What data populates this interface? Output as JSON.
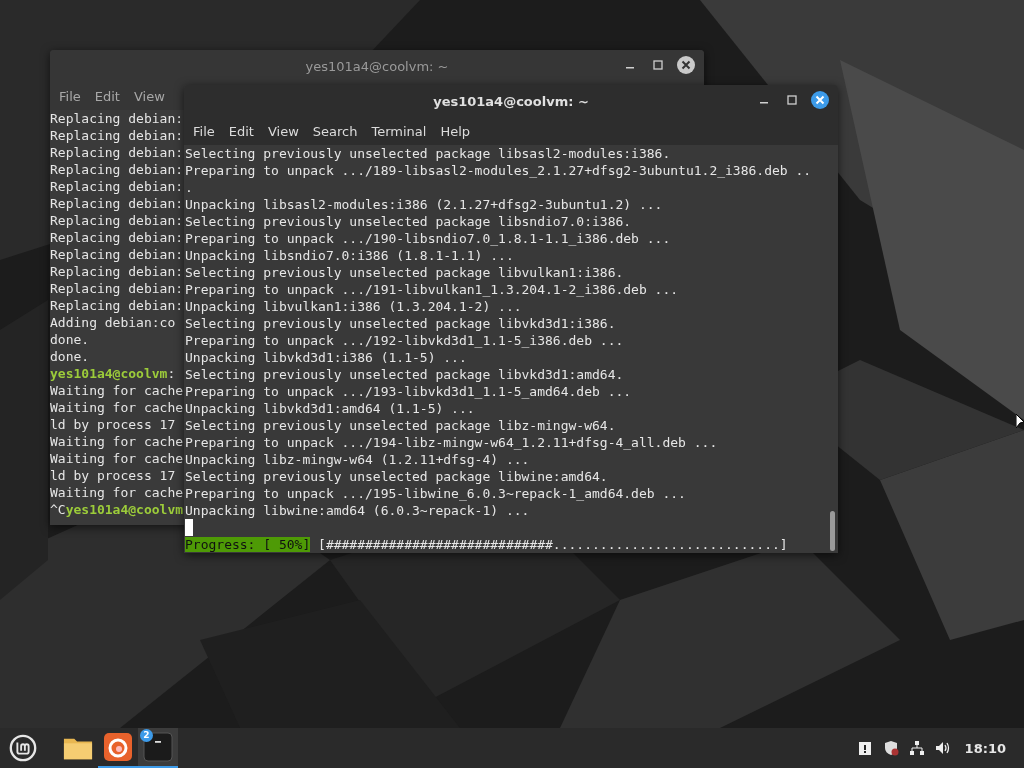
{
  "windows": [
    {
      "title": "yes101a4@coolvm: ~",
      "focused": false,
      "menu": [
        "File",
        "Edit",
        "View"
      ],
      "lines": [
        {
          "segments": [
            {
              "kind": "output",
              "text": "Replacing debian:"
            }
          ]
        },
        {
          "segments": [
            {
              "kind": "output",
              "text": "Replacing debian:"
            }
          ]
        },
        {
          "segments": [
            {
              "kind": "output",
              "text": "Replacing debian:"
            }
          ]
        },
        {
          "segments": [
            {
              "kind": "output",
              "text": "Replacing debian:"
            }
          ]
        },
        {
          "segments": [
            {
              "kind": "output",
              "text": "Replacing debian:"
            }
          ]
        },
        {
          "segments": [
            {
              "kind": "output",
              "text": "Replacing debian:"
            }
          ]
        },
        {
          "segments": [
            {
              "kind": "output",
              "text": "Replacing debian:"
            }
          ]
        },
        {
          "segments": [
            {
              "kind": "output",
              "text": "Replacing debian:"
            }
          ]
        },
        {
          "segments": [
            {
              "kind": "output",
              "text": "Replacing debian:"
            }
          ]
        },
        {
          "segments": [
            {
              "kind": "output",
              "text": "Replacing debian:"
            }
          ]
        },
        {
          "segments": [
            {
              "kind": "output",
              "text": "Replacing debian:"
            }
          ]
        },
        {
          "segments": [
            {
              "kind": "output",
              "text": "Replacing debian:"
            }
          ]
        },
        {
          "segments": [
            {
              "kind": "output",
              "text": "Adding debian:co"
            }
          ]
        },
        {
          "segments": [
            {
              "kind": "output",
              "text": "done."
            }
          ]
        },
        {
          "segments": [
            {
              "kind": "output",
              "text": "done."
            }
          ]
        },
        {
          "segments": [
            {
              "kind": "prompt",
              "text": "yes101a4@coolvm"
            },
            {
              "kind": "output",
              "text": ":"
            }
          ]
        },
        {
          "segments": [
            {
              "kind": "output",
              "text": "Waiting for cache"
            }
          ]
        },
        {
          "segments": [
            {
              "kind": "output",
              "text": "Waiting for cache"
            }
          ]
        },
        {
          "segments": [
            {
              "kind": "output",
              "text": "ld by process 17"
            }
          ]
        },
        {
          "segments": [
            {
              "kind": "output",
              "text": "Waiting for cache"
            }
          ]
        },
        {
          "segments": [
            {
              "kind": "output",
              "text": "Waiting for cache"
            }
          ]
        },
        {
          "segments": [
            {
              "kind": "output",
              "text": "ld by process 17"
            }
          ]
        },
        {
          "segments": [
            {
              "kind": "output",
              "text": "Waiting for cache"
            }
          ]
        },
        {
          "segments": [
            {
              "kind": "output",
              "text": "^C"
            },
            {
              "kind": "prompt",
              "text": "yes101a4@coolvm"
            }
          ]
        }
      ]
    },
    {
      "title": "yes101a4@coolvm: ~",
      "focused": true,
      "menu": [
        "File",
        "Edit",
        "View",
        "Search",
        "Terminal",
        "Help"
      ],
      "lines": [
        {
          "segments": [
            {
              "kind": "output",
              "text": "Selecting previously unselected package libsasl2-modules:i386."
            }
          ]
        },
        {
          "segments": [
            {
              "kind": "output",
              "text": "Preparing to unpack .../189-libsasl2-modules_2.1.27+dfsg2-3ubuntu1.2_i386.deb .."
            }
          ]
        },
        {
          "segments": [
            {
              "kind": "output",
              "text": "."
            }
          ]
        },
        {
          "segments": [
            {
              "kind": "output",
              "text": "Unpacking libsasl2-modules:i386 (2.1.27+dfsg2-3ubuntu1.2) ..."
            }
          ]
        },
        {
          "segments": [
            {
              "kind": "output",
              "text": "Selecting previously unselected package libsndio7.0:i386."
            }
          ]
        },
        {
          "segments": [
            {
              "kind": "output",
              "text": "Preparing to unpack .../190-libsndio7.0_1.8.1-1.1_i386.deb ..."
            }
          ]
        },
        {
          "segments": [
            {
              "kind": "output",
              "text": "Unpacking libsndio7.0:i386 (1.8.1-1.1) ..."
            }
          ]
        },
        {
          "segments": [
            {
              "kind": "output",
              "text": "Selecting previously unselected package libvulkan1:i386."
            }
          ]
        },
        {
          "segments": [
            {
              "kind": "output",
              "text": "Preparing to unpack .../191-libvulkan1_1.3.204.1-2_i386.deb ..."
            }
          ]
        },
        {
          "segments": [
            {
              "kind": "output",
              "text": "Unpacking libvulkan1:i386 (1.3.204.1-2) ..."
            }
          ]
        },
        {
          "segments": [
            {
              "kind": "output",
              "text": "Selecting previously unselected package libvkd3d1:i386."
            }
          ]
        },
        {
          "segments": [
            {
              "kind": "output",
              "text": "Preparing to unpack .../192-libvkd3d1_1.1-5_i386.deb ..."
            }
          ]
        },
        {
          "segments": [
            {
              "kind": "output",
              "text": "Unpacking libvkd3d1:i386 (1.1-5) ..."
            }
          ]
        },
        {
          "segments": [
            {
              "kind": "output",
              "text": "Selecting previously unselected package libvkd3d1:amd64."
            }
          ]
        },
        {
          "segments": [
            {
              "kind": "output",
              "text": "Preparing to unpack .../193-libvkd3d1_1.1-5_amd64.deb ..."
            }
          ]
        },
        {
          "segments": [
            {
              "kind": "output",
              "text": "Unpacking libvkd3d1:amd64 (1.1-5) ..."
            }
          ]
        },
        {
          "segments": [
            {
              "kind": "output",
              "text": "Selecting previously unselected package libz-mingw-w64."
            }
          ]
        },
        {
          "segments": [
            {
              "kind": "output",
              "text": "Preparing to unpack .../194-libz-mingw-w64_1.2.11+dfsg-4_all.deb ..."
            }
          ]
        },
        {
          "segments": [
            {
              "kind": "output",
              "text": "Unpacking libz-mingw-w64 (1.2.11+dfsg-4) ..."
            }
          ]
        },
        {
          "segments": [
            {
              "kind": "output",
              "text": "Selecting previously unselected package libwine:amd64."
            }
          ]
        },
        {
          "segments": [
            {
              "kind": "output",
              "text": "Preparing to unpack .../195-libwine_6.0.3~repack-1_amd64.deb ..."
            }
          ]
        },
        {
          "segments": [
            {
              "kind": "output",
              "text": "Unpacking libwine:amd64 (6.0.3~repack-1) ..."
            }
          ]
        },
        {
          "cursor": true
        },
        {
          "segments": [
            {
              "kind": "progress",
              "text": "Progress: [ 50%]"
            },
            {
              "kind": "output",
              "text": " [#############################.............................]"
            }
          ]
        }
      ]
    }
  ],
  "taskbar": {
    "launchers": [
      {
        "kind": "menu",
        "running": false,
        "selected": false
      },
      {
        "kind": "folder",
        "running": false,
        "selected": false
      },
      {
        "kind": "browser",
        "running": true,
        "selected": false
      },
      {
        "kind": "terminal",
        "running": true,
        "selected": true,
        "badge": "2"
      }
    ],
    "clock": "18:10"
  }
}
